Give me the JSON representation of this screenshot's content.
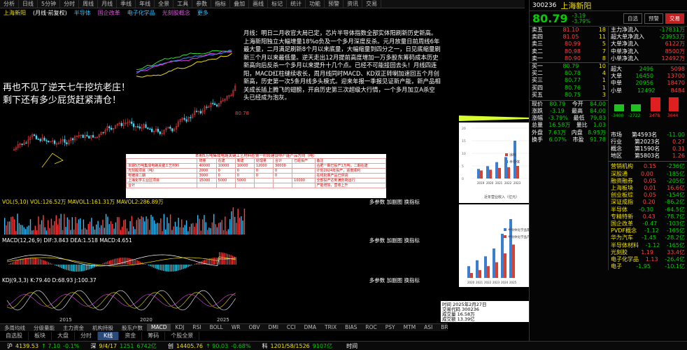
{
  "toolbar": {
    "items": [
      "分析",
      "日线",
      "5分钟",
      "分时",
      "周线",
      "月线",
      "季线",
      "年线",
      "全景",
      "工具",
      "参数",
      "指标",
      "叠加",
      "画线",
      "标记",
      "统计",
      "功能",
      "预警",
      "资讯",
      "交易"
    ]
  },
  "title": {
    "name": "上海新阳",
    "market": "(月线·前复权)",
    "tags": [
      "半导体",
      "国企改革",
      "电子化学品",
      "光刻胶概念",
      "更多"
    ]
  },
  "annotation": "月线：明日二月收官大局已定，芯片半导体指数全部实体阳刷新历史新高。上海新阳独立大幅增量18%o负及一个多月深度反杀。元月放量日前周线6年最大量，二月满足刷新8个月以来底量，大幅缩量到四分之一，日见底缩量刷新三个月以来最低量。逆天走出12月提前高度增加一万多股东筹码成本历史新高向后反杀一个多月以来提升十几个点。已经不可能接回去头！月线四连阳，MACD红柱缝续收长，周月线同时MACD、KD双正转喇加速回五个月创新高，历史第一次5条月线多头模式。迎来年报一季报见证新产能，新产品相关成长插上腾飞的翅膀，开启历史第三次超级大行情，一个多月加立A杀空头已经成为泡灰。",
  "overlay": [
    "再也不见了逆天七午挖坑老庄！",
    "剩下还有多少屁货赶紧清仓！"
  ],
  "price_label": "80.78",
  "table": {
    "title": "本期5万吨集成电路关键工艺材料在第一阶段建设中产能产品方向（吨）",
    "headers": [
      "",
      "增量",
      "在建",
      "新建",
      "处理量",
      "合计",
      "已经投产",
      "备注"
    ],
    "rows": [
      [
        "本期5万吨集成电路关键工艺材料",
        "40000",
        "10000",
        "10000",
        "12000",
        "30000",
        "",
        "合肥一期已投产1万吨，二期在建"
      ],
      [
        "光刻胶项目（吨）",
        "2000",
        "0",
        "0",
        "0",
        "0",
        "",
        "计划2024年投产，进度顺利"
      ],
      [
        "电镀液二期",
        "3000",
        "0",
        "0",
        "0",
        "0",
        "",
        "在线批量产品已供货"
      ],
      [
        "上海化学工业区项目",
        "15000",
        "5000",
        "5000",
        "",
        "",
        "10000",
        "全部投产达到满负荷运行"
      ],
      [
        "合计",
        "",
        "",
        "",
        "",
        "",
        "",
        "产能增加，营收上升"
      ]
    ]
  },
  "panels": {
    "vol": "VOL(5,10)  VOL:126.52万  MAVOL1:161.31万  MAVOL2:286.89万",
    "macd": "MACD(12,26,9)  DIF:3.843  DEA:1.518  MACD:4.651",
    "kdj": "KDJ(9,3,3)  K:79.40  D:68.93  J:100.37",
    "right_tools": [
      "多参数",
      "加副图",
      "换指标"
    ]
  },
  "xaxis": [
    "2015",
    "2020",
    "2025"
  ],
  "chart_tabs": [
    "多周均线",
    "分级量能",
    "主力资金",
    "机构持股",
    "股东户数",
    "MACD",
    "KDJ",
    "RSI",
    "BOLL",
    "WR",
    "OBV",
    "DMI",
    "CCI",
    "DMA",
    "TRIX",
    "BIAS",
    "ROC",
    "PSY",
    "MTM",
    "ASI",
    "BRAR",
    "VR",
    "EXPMA",
    "SAR",
    "CR"
  ],
  "stock_tabs": [
    "自选股",
    "板块",
    "大盘",
    "分时",
    "K线",
    "资金",
    "筹码",
    "个股全景"
  ],
  "status": [
    {
      "label": "沪",
      "val": "4139.53",
      "chg": "↑ 7.10",
      "pct": "-0.1%"
    },
    {
      "label": "深",
      "val": "9/4/17",
      "chg": "1251",
      "pct": "6742亿"
    },
    {
      "label": "创",
      "val": "14405.76",
      "chg": "↑ 90.03",
      "pct": "-0.68%"
    },
    {
      "label": "科",
      "val": "1201/58/1526",
      "chg": "9107亿",
      "pct": ""
    },
    {
      "label": "时间",
      "val": "",
      "chg": "",
      "pct": ""
    }
  ],
  "quote": {
    "code": "300236",
    "name": "上海新阳",
    "price": "80.79",
    "change": "-3.19",
    "pct": "-3.79%",
    "buttons": [
      "自选",
      "预警",
      "交易"
    ]
  },
  "depth": {
    "ask": [
      [
        "卖五",
        "81.10",
        "18"
      ],
      [
        "卖四",
        "81.05",
        "11"
      ],
      [
        "卖三",
        "80.99",
        "5"
      ],
      [
        "卖二",
        "80.98",
        "7"
      ],
      [
        "卖一",
        "80.90",
        "8"
      ]
    ],
    "bid": [
      [
        "买一",
        "80.79",
        "10"
      ],
      [
        "买二",
        "80.78",
        "4"
      ],
      [
        "买三",
        "80.77",
        "1"
      ],
      [
        "买四",
        "80.76",
        "1"
      ],
      [
        "买五",
        "80.75",
        "3"
      ]
    ]
  },
  "stats": [
    [
      "现价",
      "80.79",
      "今开",
      "84.00"
    ],
    [
      "涨跌",
      "-3.19",
      "最高",
      "84.00"
    ],
    [
      "涨幅",
      "-3.79%",
      "最低",
      "79.83"
    ],
    [
      "总量",
      "16.58万",
      "量比",
      "1.03"
    ],
    [
      "外盘",
      "7.63万",
      "内盘",
      "8.95万"
    ],
    [
      "换手",
      "6.07%",
      "市盈",
      "91.78"
    ]
  ],
  "flows": [
    [
      "主力净流入",
      "-17831万"
    ],
    [
      "超大单净流入",
      "-23953万"
    ],
    [
      "大单净流入",
      "6122万"
    ],
    [
      "中单净流入",
      "8500万"
    ],
    [
      "小单净流入",
      "12492万"
    ]
  ],
  "flow_table": [
    [
      "超大",
      "2496",
      "5098"
    ],
    [
      "大单",
      "16450",
      "13700"
    ],
    [
      "中单",
      "20956",
      "18470"
    ],
    [
      "小单",
      "12492",
      "8484"
    ]
  ],
  "rank": {
    "items": [
      [
        "市场",
        "第4593名",
        "-11.00"
      ],
      [
        "行业",
        "第2023名",
        "0.27"
      ],
      [
        "概念",
        "第1590名",
        "0.31"
      ],
      [
        "地区",
        "第5803名",
        "1.26"
      ]
    ]
  },
  "sectors": [
    [
      "营销机构",
      "0.15",
      "-236亿"
    ],
    [
      "深股通",
      "0.00",
      "-185亿"
    ],
    [
      "融资融券",
      "0.05",
      "-205亿"
    ],
    [
      "上海板块",
      "0.01",
      "16.6亿"
    ],
    [
      "创业板综",
      "0.05",
      "-154亿"
    ],
    [
      "深证成指",
      "0.20",
      "-86.2亿"
    ],
    [
      "半导体",
      "-0.30",
      "-64.5亿"
    ],
    [
      "专精特新",
      "0.43",
      "-78.7亿"
    ],
    [
      "国企改革",
      "-0.47",
      "-103亿"
    ],
    [
      "PVDF概念",
      "-1.12",
      "-165亿"
    ],
    [
      "华为汽车",
      "-1.45",
      "-28.2亿"
    ],
    [
      "半导体材料",
      "-1.12",
      "-165亿"
    ],
    [
      "光刻胶",
      "1.19",
      "33.4亿"
    ],
    [
      "电子化学品",
      "1.13",
      "-26.4亿"
    ],
    [
      "电子",
      "-1.95",
      "-10.1亿"
    ]
  ],
  "chart_a": {
    "title": "近年营业收入（亿元）",
    "years": [
      "2019",
      "2020",
      "2021",
      "2022",
      "2023"
    ],
    "legend": [
      "涂料",
      "半导体"
    ],
    "series_a": [
      3.2,
      3.5,
      4.2,
      4.5,
      5.0
    ],
    "series_b": [
      3.8,
      4.9,
      6.5,
      8.5,
      15.0
    ]
  },
  "chart_b": {
    "legend": [
      "半导体化学品需求（万吨）",
      "半导体化学品产出（万吨）"
    ],
    "years": [
      "2020",
      "2021",
      "2022",
      "2023",
      "2024",
      "2025"
    ],
    "series_a": [
      1.2,
      1.8,
      2.2,
      3.0,
      4.5,
      6.0
    ],
    "series_b": [
      0.5,
      0.8,
      1.2,
      1.6,
      2.5,
      3.4
    ]
  },
  "time_box": [
    "时间 2025年2月27日",
    "交易代码  300236",
    "成交量  16.58万",
    "成交额  13.39亿"
  ]
}
